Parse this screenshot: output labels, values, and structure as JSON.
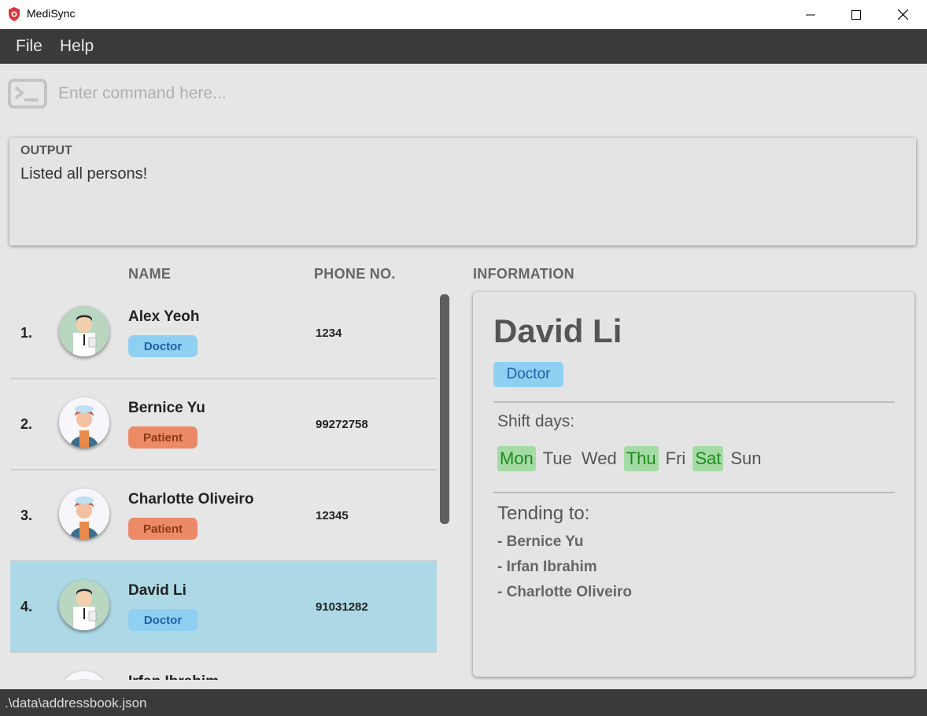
{
  "window": {
    "title": "MediSync"
  },
  "menu": {
    "file": "File",
    "help": "Help"
  },
  "command": {
    "placeholder": "Enter command here...",
    "value": ""
  },
  "output": {
    "label": "OUTPUT",
    "message": "Listed all persons!"
  },
  "columns": {
    "name": "NAME",
    "phone": "PHONE NO.",
    "information": "INFORMATION"
  },
  "persons": [
    {
      "index": "1.",
      "name": "Alex Yeoh",
      "role": "Doctor",
      "phone": "1234",
      "avatar": "doctor-avatar-icon"
    },
    {
      "index": "2.",
      "name": "Bernice Yu",
      "role": "Patient",
      "phone": "99272758",
      "avatar": "patient-avatar-icon"
    },
    {
      "index": "3.",
      "name": "Charlotte Oliveiro",
      "role": "Patient",
      "phone": "12345",
      "avatar": "patient-avatar-icon"
    },
    {
      "index": "4.",
      "name": "David Li",
      "role": "Doctor",
      "phone": "91031282",
      "avatar": "doctor-avatar-icon",
      "selected": true
    },
    {
      "index": "",
      "name": "Irfan Ibrahim",
      "role": "",
      "phone": "",
      "avatar": "patient-avatar-icon"
    }
  ],
  "info": {
    "name": "David Li",
    "role": "Doctor",
    "shift_label": "Shift days:",
    "days": [
      {
        "label": "Mon",
        "active": true
      },
      {
        "label": "Tue",
        "active": false
      },
      {
        "label": "Wed",
        "active": false
      },
      {
        "label": "Thu",
        "active": true
      },
      {
        "label": "Fri",
        "active": false
      },
      {
        "label": "Sat",
        "active": true
      },
      {
        "label": "Sun",
        "active": false
      }
    ],
    "tending_label": "Tending to:",
    "tending": [
      "- Bernice Yu",
      "- Irfan Ibrahim",
      "- Charlotte Oliveiro"
    ]
  },
  "status": {
    "path": ".\\data\\addressbook.json"
  },
  "colors": {
    "doctor_tag": "#8fd0f2",
    "patient_tag": "#ec8a68",
    "selected_row": "#add8e6",
    "active_day": "#a4dba4"
  }
}
